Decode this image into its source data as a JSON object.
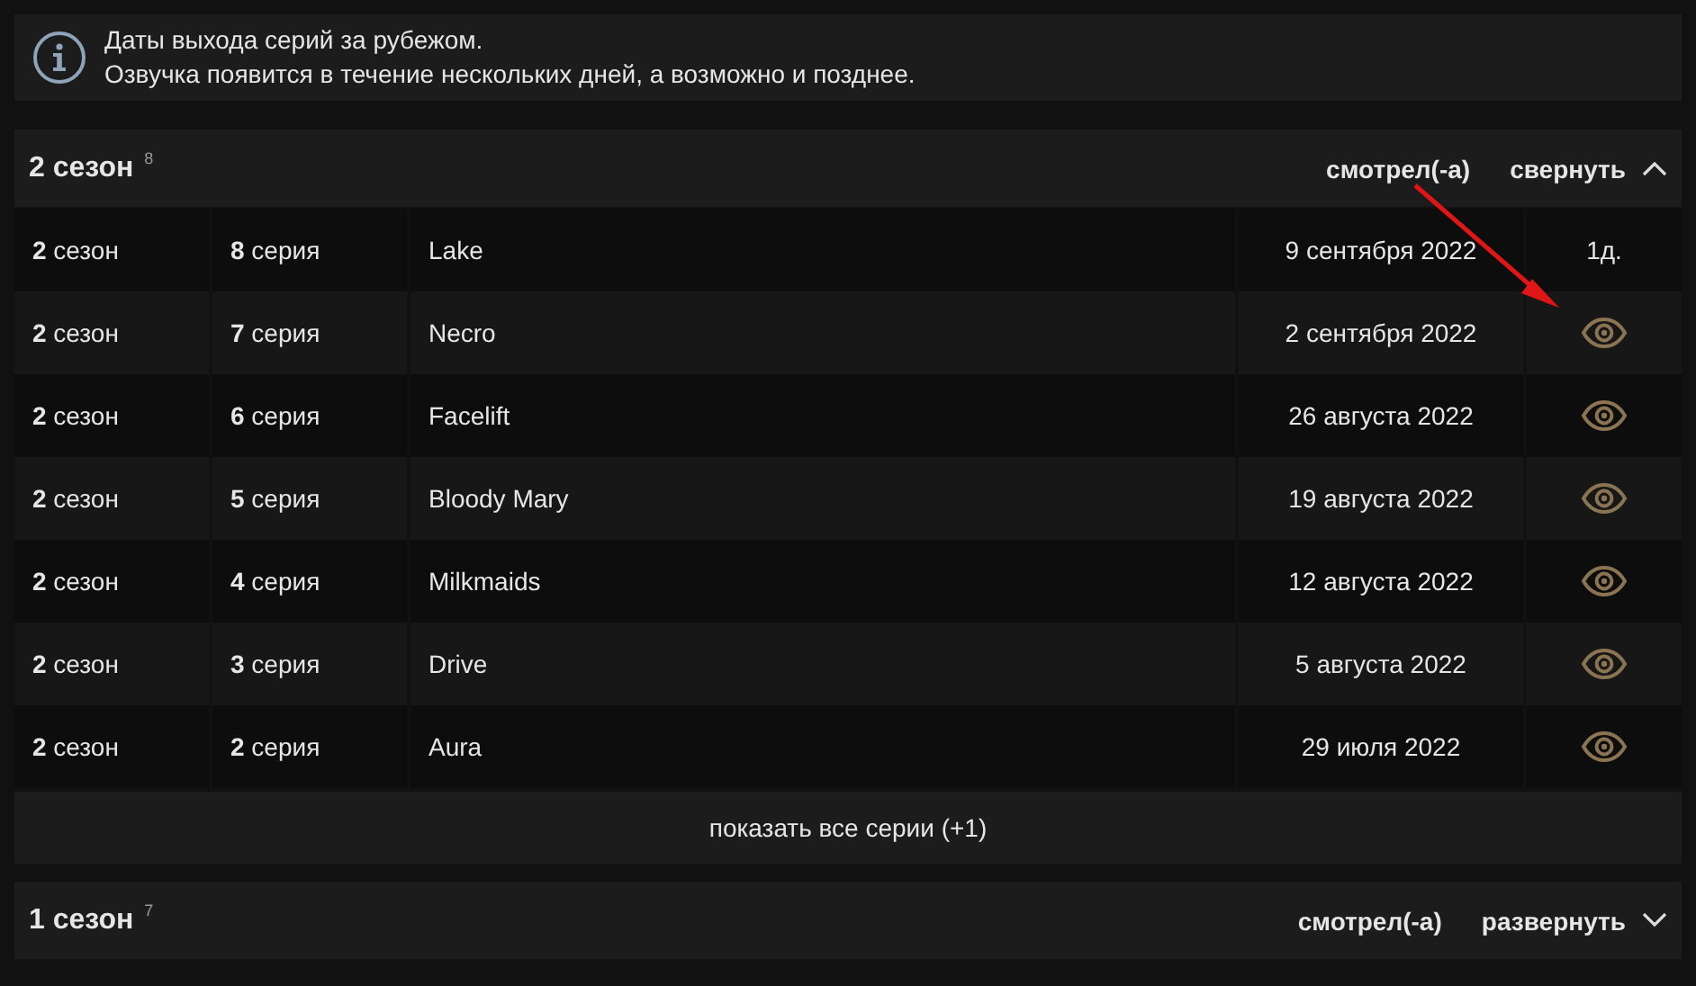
{
  "notice": {
    "lines": [
      "Даты выхода серий за рубежом.",
      "Озвучка появится в течение нескольких дней, а возможно и позднее."
    ]
  },
  "seasons": [
    {
      "title": "2 сезон",
      "count": "8",
      "watched_label": "смотрел(-а)",
      "toggle_label": "свернуть",
      "expanded": true,
      "episodes": [
        {
          "season": "**2** сезон",
          "episode": "**8** серия",
          "name": "Lake",
          "date": "9 сентября 2022",
          "kind": "countdown",
          "status": "1д."
        },
        {
          "season": "**2** сезон",
          "episode": "**7** серия",
          "name": "Necro",
          "date": "2 сентября 2022",
          "kind": "eye"
        },
        {
          "season": "**2** сезон",
          "episode": "**6** серия",
          "name": "Facelift",
          "date": "26 августа 2022",
          "kind": "eye"
        },
        {
          "season": "**2** сезон",
          "episode": "**5** серия",
          "name": "Bloody Mary",
          "date": "19 августа 2022",
          "kind": "eye"
        },
        {
          "season": "**2** сезон",
          "episode": "**4** серия",
          "name": "Milkmaids",
          "date": "12 августа 2022",
          "kind": "eye"
        },
        {
          "season": "**2** сезон",
          "episode": "**3** серия",
          "name": "Drive",
          "date": "5 августа 2022",
          "kind": "eye"
        },
        {
          "season": "**2** сезон",
          "episode": "**2** серия",
          "name": "Aura",
          "date": "29 июля 2022",
          "kind": "eye"
        }
      ],
      "show_all": "показать все серии (+1)"
    },
    {
      "title": "1 сезон",
      "count": "7",
      "watched_label": "смотрел(-а)",
      "toggle_label": "развернуть",
      "expanded": false
    }
  ]
}
